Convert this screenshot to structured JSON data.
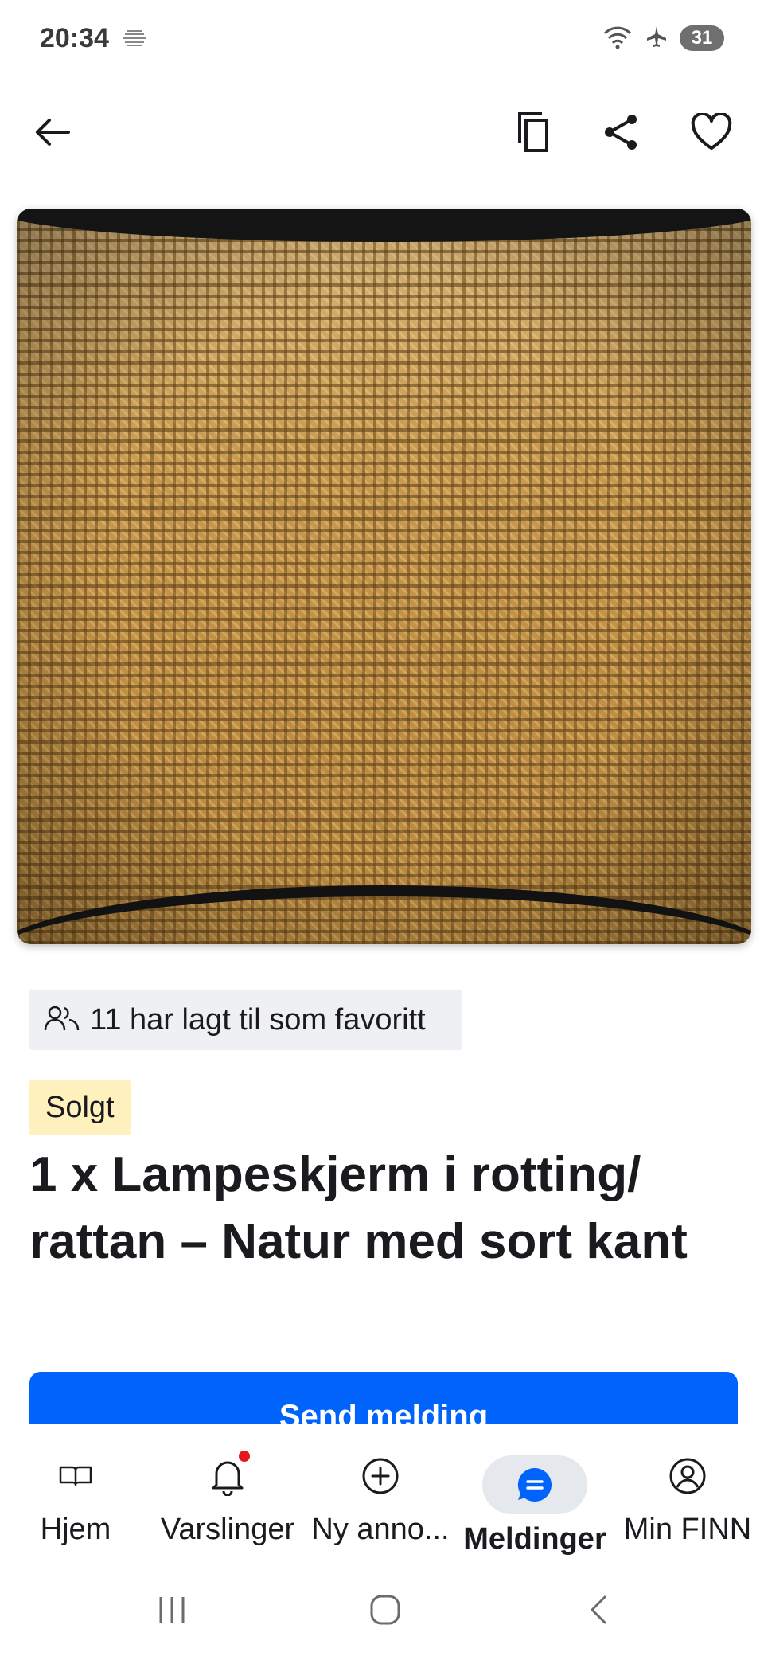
{
  "status_bar": {
    "time": "20:34",
    "battery": "31",
    "icons": [
      "settings-gear-icon",
      "wifi-icon",
      "airplane-icon"
    ]
  },
  "top_bar": {
    "icons": [
      "back-arrow-icon",
      "copy-icon",
      "share-icon",
      "heart-icon"
    ]
  },
  "listing": {
    "favorites_text": "11 har lagt til som favoritt",
    "status_badge": "Solgt",
    "title": "1 x Lampeskjerm i rotting/ rattan – Natur med sort kant",
    "cta_label": "Send melding"
  },
  "bottom_nav": {
    "items": [
      {
        "label": "Hjem",
        "icon": "book-icon"
      },
      {
        "label": "Varslinger",
        "icon": "bell-icon"
      },
      {
        "label": "Ny anno...",
        "icon": "plus-circle-icon"
      },
      {
        "label": "Meldinger",
        "icon": "chat-icon"
      },
      {
        "label": "Min FINN",
        "icon": "user-circle-icon"
      }
    ]
  },
  "system_nav": {
    "icons": [
      "recents-icon",
      "home-icon",
      "back-icon"
    ]
  },
  "colors": {
    "primary": "#0063fb",
    "sold_badge_bg": "#fff1bd",
    "chip_bg": "#eef0f3",
    "active_nav_bg": "#e5e9ee",
    "notification_dot": "#e31a1c"
  }
}
